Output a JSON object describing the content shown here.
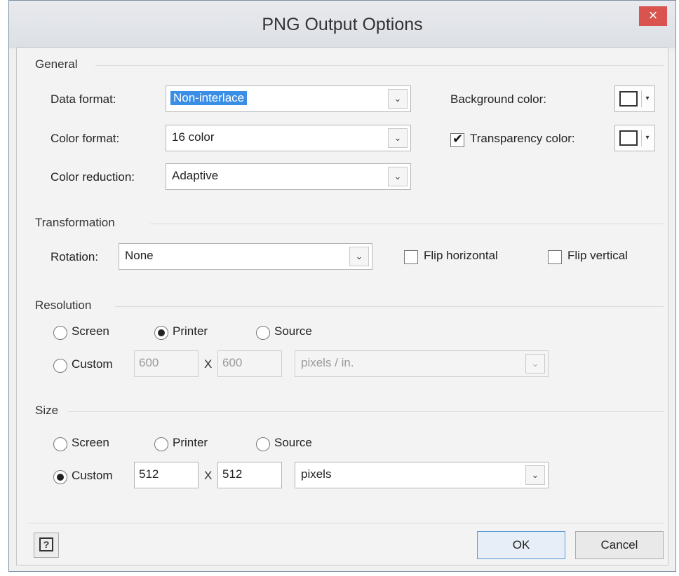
{
  "dialog": {
    "title": "PNG Output Options",
    "close_glyph": "×"
  },
  "general": {
    "section_label": "General",
    "data_format": {
      "label": "Data format:",
      "value": "Non-interlace"
    },
    "color_format": {
      "label": "Color format:",
      "value": "16 color"
    },
    "color_reduction": {
      "label": "Color reduction:",
      "value": "Adaptive"
    },
    "background_color": {
      "label": "Background color:",
      "swatch_color": "#ffffff"
    },
    "transparency_color": {
      "label": "Transparency color:",
      "checked": true,
      "swatch_color": "#ffffff"
    }
  },
  "transformation": {
    "section_label": "Transformation",
    "rotation": {
      "label": "Rotation:",
      "value": "None"
    },
    "flip_horizontal": {
      "label": "Flip horizontal",
      "checked": false
    },
    "flip_vertical": {
      "label": "Flip vertical",
      "checked": false
    }
  },
  "resolution": {
    "section_label": "Resolution",
    "options": {
      "screen": "Screen",
      "printer": "Printer",
      "source": "Source",
      "custom": "Custom"
    },
    "selected": "printer",
    "width": "600",
    "height": "600",
    "times": "X",
    "unit": "pixels / in."
  },
  "size": {
    "section_label": "Size",
    "options": {
      "screen": "Screen",
      "printer": "Printer",
      "source": "Source",
      "custom": "Custom"
    },
    "selected": "custom",
    "width": "512",
    "height": "512",
    "times": "X",
    "unit": "pixels"
  },
  "footer": {
    "help_glyph": "?",
    "ok_label": "OK",
    "cancel_label": "Cancel"
  },
  "glyphs": {
    "dropdown_arrow": "⌄",
    "color_dropdown": "▾",
    "checkmark": "✔"
  },
  "colors": {
    "selection": "#3a8ee6",
    "close_button": "#d9534f"
  }
}
